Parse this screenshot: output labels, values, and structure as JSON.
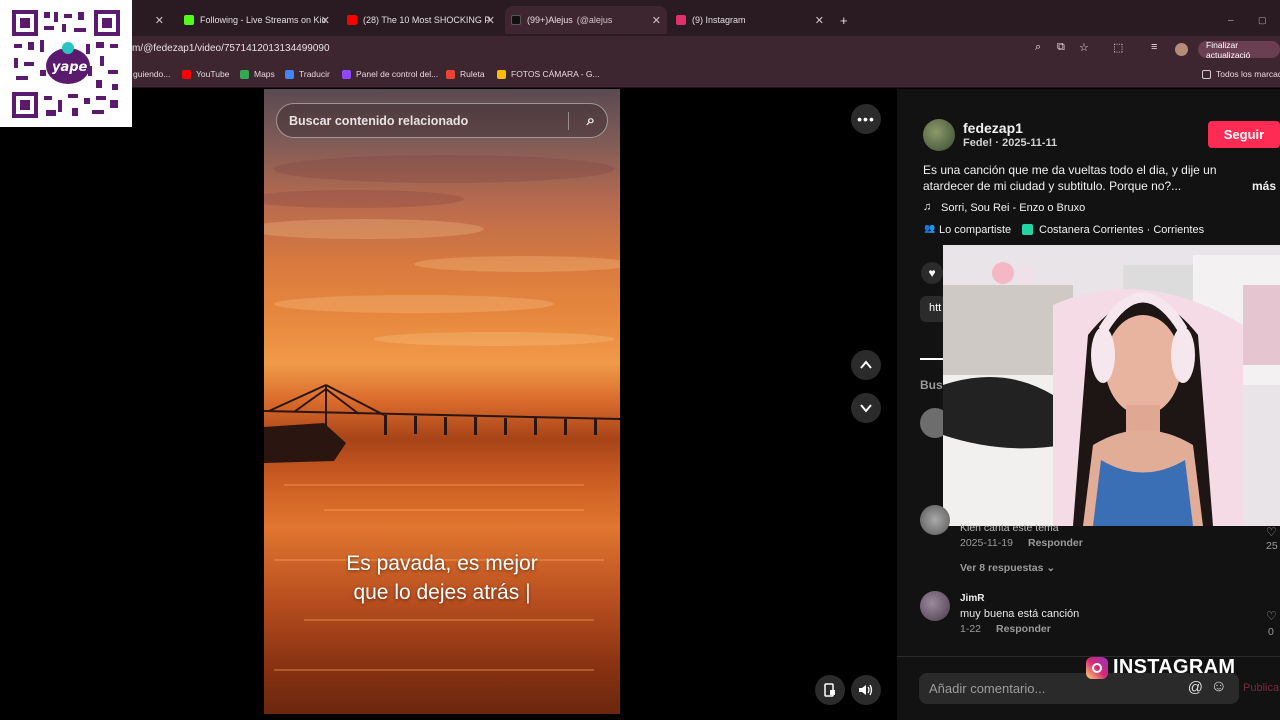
{
  "browser": {
    "tabs": [
      {
        "label": "Following - Live Streams on Kic",
        "icon_color": "#53fc18"
      },
      {
        "label": "(28) The 10 Most SHOCKING P",
        "icon_color": "#ff0000"
      },
      {
        "label": "(99+)Alejus",
        "suffix": "(@alejus",
        "icon_color": "#111111"
      },
      {
        "label": "(9) Instagram",
        "icon_color": "#e1306c"
      }
    ],
    "new_tab": "+",
    "url": "m/@fedezap1/video/7571412013134499090",
    "update_button": "Finalizar actualizació",
    "bookmarks": [
      "guiendo...",
      "YouTube",
      "Maps",
      "Traducir",
      "Panel de control del...",
      "Ruleta",
      "FOTOS CÁMARA - G..."
    ],
    "all_bookmarks": "Todos los marcad",
    "accent": "#fe2c55"
  },
  "video": {
    "search_placeholder": "Buscar contenido relacionado",
    "caption_line1": "Es pavada, es mejor",
    "caption_line2": "que lo dejes atrás |"
  },
  "post": {
    "username": "fedezap1",
    "subtitle": "Fede! · 2025-11-11",
    "follow_label": "Seguir",
    "description_line1": "Es una canción que me da vueltas todo el dia, y dije un",
    "description_line2": "atardecer de mi ciudad y subtitulo. Porque no?...",
    "more": "más",
    "music": "Sorri, Sou Rei - Enzo o Bruxo",
    "shared": "Lo compartiste",
    "location": "Costanera Corrientes · Corrientes",
    "link_fragment": "htt",
    "search_fragment": "Bus"
  },
  "comments": [
    {
      "name": "",
      "text": "Kien canta este tema",
      "date": "2025-11-19",
      "reply": "Responder",
      "likes": "25",
      "replies": "Ver 8 respuestas"
    },
    {
      "name": "JimR",
      "text": "muy buena está canción",
      "date": "1-22",
      "reply": "Responder",
      "likes": "0"
    }
  ],
  "comment_input": {
    "placeholder": "Añadir comentario...",
    "publish": "Publica"
  },
  "overlay": {
    "qr_label": "yape",
    "instagram_label": "INSTAGRAM"
  }
}
